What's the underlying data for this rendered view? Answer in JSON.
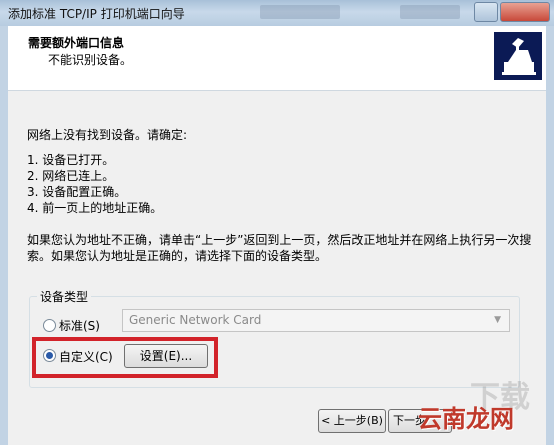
{
  "window": {
    "title": "添加标准 TCP/IP 打印机端口向导"
  },
  "header": {
    "title": "需要额外端口信息",
    "subtitle": "不能识别设备。"
  },
  "body": {
    "intro": "网络上没有找到设备。请确定:",
    "checklist": [
      "1.  设备已打开。",
      "2.  网络已连上。",
      "3.  设备配置正确。",
      "4.  前一页上的地址正确。"
    ],
    "advice_line1": "如果您认为地址不正确，请单击“上一步”返回到上一页，然后改正地址并在网络上执行另一次搜",
    "advice_line2": "索。如果您认为地址是正确的，请选择下面的设备类型。"
  },
  "device_type": {
    "group_label": "设备类型",
    "standard_label": "标准(S)",
    "standard_selected": false,
    "standard_value": "Generic Network Card",
    "custom_label": "自定义(C)",
    "custom_selected": true,
    "settings_button": "设置(E)..."
  },
  "footer": {
    "back_button": "< 上一步(B)",
    "next_button": "下一步"
  },
  "watermark": {
    "text": "云南龙网",
    "ghost_text": "下载"
  },
  "colors": {
    "highlight": "#d2232a",
    "icon_bg": "#0b1a55"
  }
}
